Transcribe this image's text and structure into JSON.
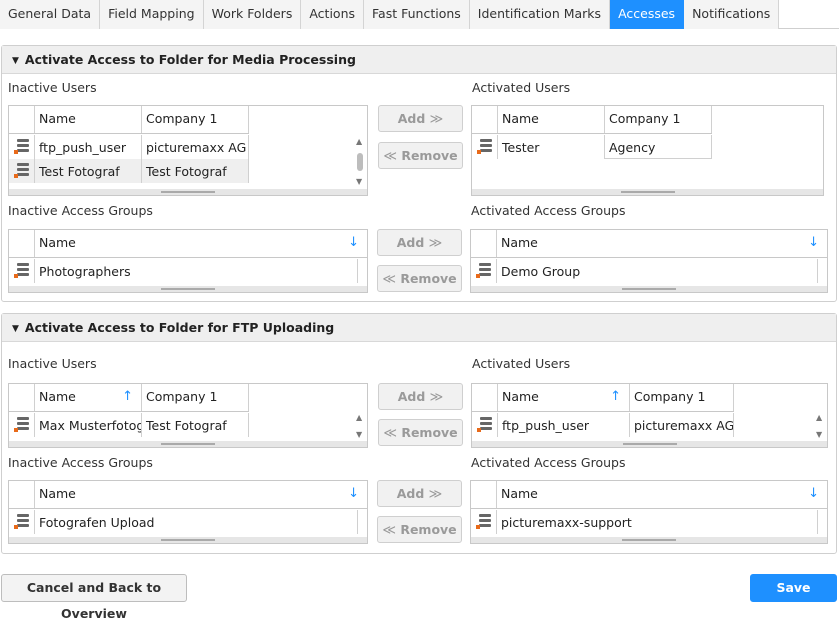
{
  "tabs": [
    "General Data",
    "Field Mapping",
    "Work Folders",
    "Actions",
    "Fast Functions",
    "Identification Marks",
    "Accesses",
    "Notifications"
  ],
  "active_tab": "Accesses",
  "colors": {
    "accent": "#1e90ff"
  },
  "media": {
    "title": "Activate Access to Folder for Media Processing",
    "inactive_users_label": "Inactive Users",
    "activated_users_label": "Activated Users",
    "inactive_groups_label": "Inactive Access Groups",
    "activated_groups_label": "Activated Access Groups",
    "col_name": "Name",
    "col_company": "Company 1",
    "inactive_users": [
      {
        "name": "ftp_push_user",
        "company": "picturemaxx AG"
      },
      {
        "name": "Test Fotograf",
        "company": "Test Fotograf"
      }
    ],
    "activated_users": [
      {
        "name": "Tester",
        "company": "Agency"
      }
    ],
    "inactive_groups": [
      "Photographers"
    ],
    "activated_groups": [
      "Demo Group"
    ]
  },
  "ftp": {
    "title": "Activate Access to Folder for FTP Uploading",
    "inactive_users_label": "Inactive Users",
    "activated_users_label": "Activated Users",
    "inactive_groups_label": "Inactive Access Groups",
    "activated_groups_label": "Activated Access Groups",
    "col_name": "Name",
    "col_company": "Company 1",
    "inactive_users": [
      {
        "name": "Max Musterfotogr",
        "company": "Test Fotograf"
      }
    ],
    "activated_users": [
      {
        "name": "ftp_push_user",
        "company": "picturemaxx AG"
      }
    ],
    "inactive_groups": [
      "Fotografen Upload"
    ],
    "activated_groups": [
      "picturemaxx-support"
    ]
  },
  "buttons": {
    "add": "Add",
    "remove": "Remove",
    "add_arrows": "≫",
    "remove_arrows": "≪",
    "cancel": "Cancel and Back to Overview",
    "save": "Save"
  },
  "icons": {
    "sort": "↓",
    "sort_asc": "↑",
    "collapse": "▼",
    "scroll_up": "▲",
    "scroll_down": "▼"
  }
}
